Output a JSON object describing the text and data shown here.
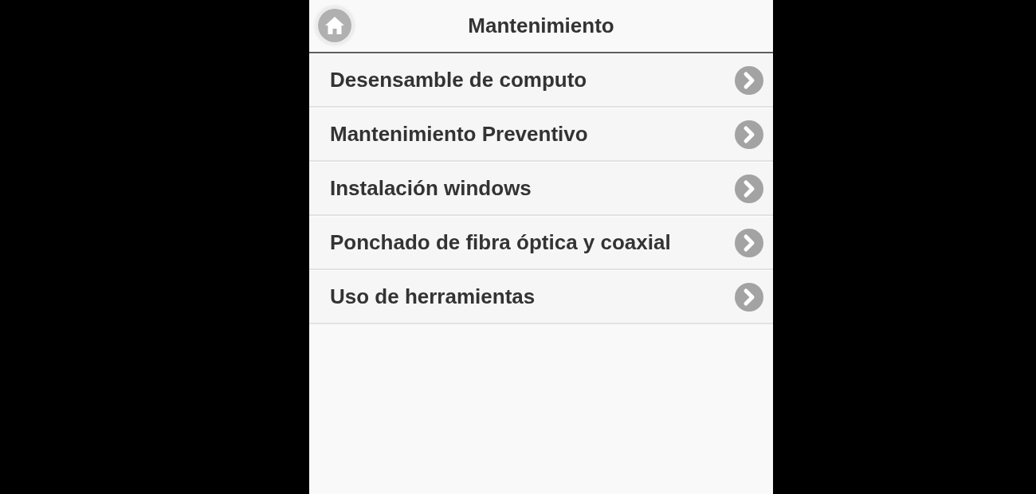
{
  "header": {
    "title": "Mantenimiento"
  },
  "menu": {
    "items": [
      {
        "label": "Desensamble de computo"
      },
      {
        "label": "Mantenimiento Preventivo"
      },
      {
        "label": "Instalación windows"
      },
      {
        "label": "Ponchado de fibra óptica y coaxial"
      },
      {
        "label": "Uso de herramientas"
      }
    ]
  }
}
